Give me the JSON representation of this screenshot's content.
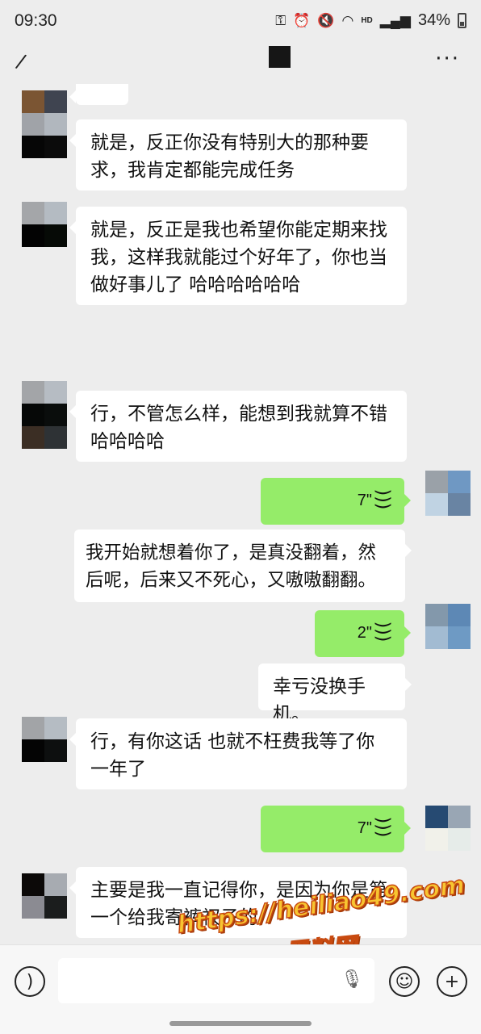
{
  "status": {
    "time": "09:30",
    "battery": "34%",
    "hd": "HD"
  },
  "nav": {
    "title_icon": "black-square-redacted",
    "more_icon": "···"
  },
  "messages": [
    {
      "side": "left",
      "text": "就是，反正你没有特别大的那种要求，我肯定都能完成任务"
    },
    {
      "side": "left",
      "text": "就是，反正是我也希望你能定期来找我，这样我就能过个好年了，你也当做好事儿了 哈哈哈哈哈哈"
    },
    {
      "side": "left",
      "text": "行，不管怎么样，能想到我就算不错 哈哈哈哈"
    },
    {
      "side": "right",
      "type": "voice",
      "duration": "7\""
    },
    {
      "side": "right",
      "type": "transcript",
      "text": "我开始就想着你了，是真没翻着，然后呢，后来又不死心，又嗷嗷翻翻。"
    },
    {
      "side": "right",
      "type": "voice",
      "duration": "2\""
    },
    {
      "side": "right",
      "type": "transcript",
      "text": "幸亏没换手机。"
    },
    {
      "side": "left",
      "text": "行，有你这话 也就不枉费我等了你一年了"
    },
    {
      "side": "right",
      "type": "voice",
      "duration": "7\""
    },
    {
      "side": "left",
      "text": "主要是我一直记得你，是因为你是第一个给我寄裤衩子的"
    }
  ],
  "watermark": {
    "url": "https://heiliao49.com",
    "name": "黑料网"
  },
  "colors": {
    "background": "#ededed",
    "bubble_self": "#95ec69",
    "bubble_other": "#ffffff"
  }
}
